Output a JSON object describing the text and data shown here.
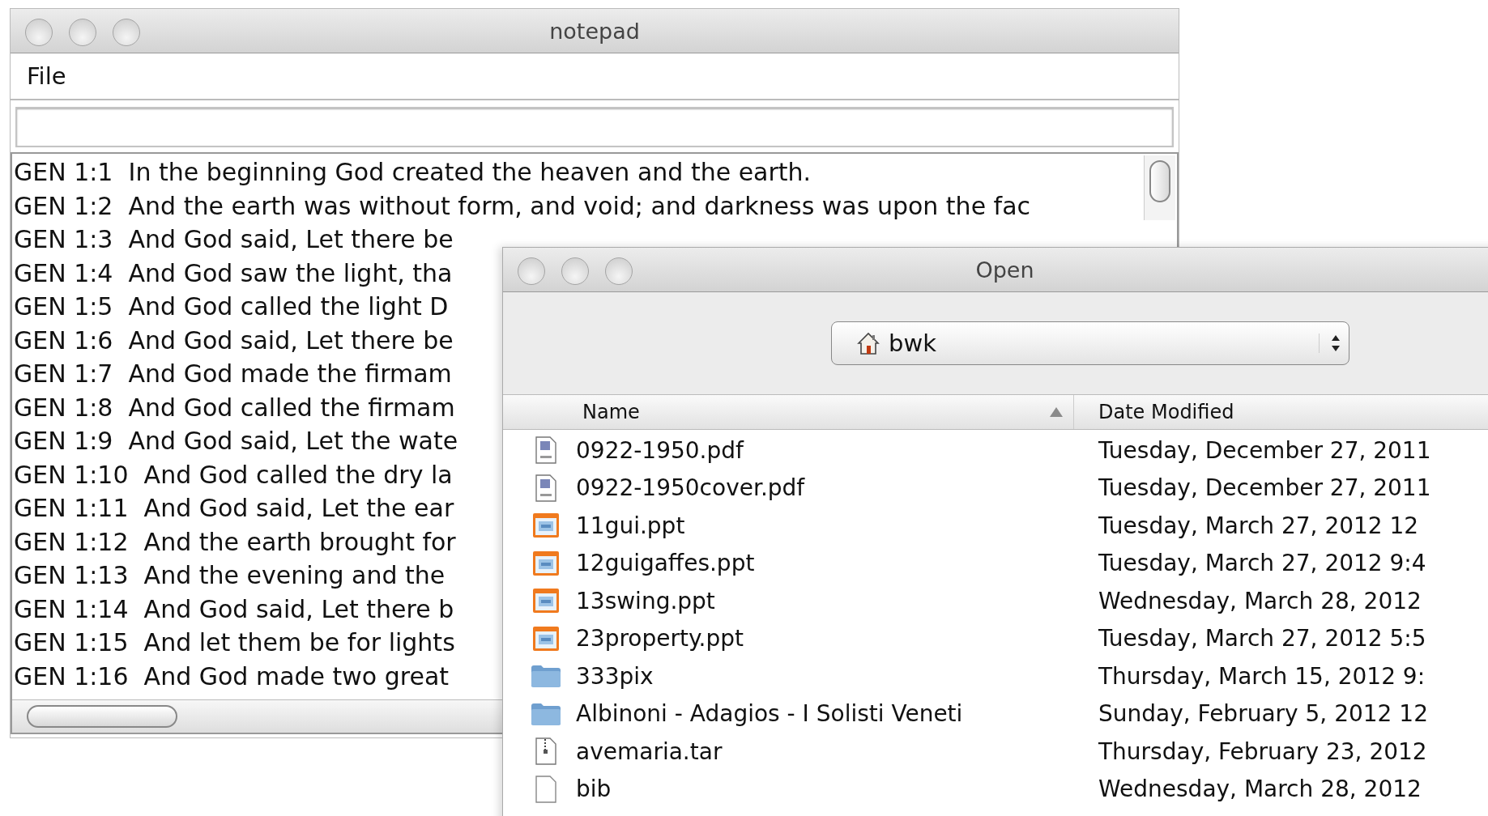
{
  "notepad": {
    "title": "notepad",
    "menu": [
      {
        "label": "File"
      }
    ],
    "lines": [
      "GEN 1:1  In the beginning God created the heaven and the earth.",
      "GEN 1:2  And the earth was without form, and void; and darkness was upon the fac",
      "GEN 1:3  And God said, Let there be",
      "GEN 1:4  And God saw the light, tha",
      "GEN 1:5  And God called the light D",
      "GEN 1:6  And God said, Let there be",
      "GEN 1:7  And God made the firmam",
      "GEN 1:8  And God called the firmam",
      "GEN 1:9  And God said, Let the wate",
      "GEN 1:10  And God called the dry la",
      "GEN 1:11  And God said, Let the ear",
      "GEN 1:12  And the earth brought for",
      "GEN 1:13  And the evening and the",
      "GEN 1:14  And God said, Let there b",
      "GEN 1:15  And let them be for lights",
      "GEN 1:16  And God made two great"
    ]
  },
  "open_dialog": {
    "title": "Open",
    "location": "bwk",
    "columns": [
      {
        "label": "Name",
        "sorted": true
      },
      {
        "label": "Date Modified",
        "sorted": false
      }
    ],
    "files": [
      {
        "name": "0922-1950.pdf",
        "date": "Tuesday, December 27, 2011",
        "kind": "pdf"
      },
      {
        "name": "0922-1950cover.pdf",
        "date": "Tuesday, December 27, 2011",
        "kind": "pdf"
      },
      {
        "name": "11gui.ppt",
        "date": "Tuesday, March 27, 2012 12",
        "kind": "ppt"
      },
      {
        "name": "12guigaffes.ppt",
        "date": "Tuesday, March 27, 2012 9:4",
        "kind": "ppt"
      },
      {
        "name": "13swing.ppt",
        "date": "Wednesday, March 28, 2012",
        "kind": "ppt"
      },
      {
        "name": "23property.ppt",
        "date": "Tuesday, March 27, 2012 5:5",
        "kind": "ppt"
      },
      {
        "name": "333pix",
        "date": "Thursday, March 15, 2012 9:",
        "kind": "folder"
      },
      {
        "name": "Albinoni - Adagios - I Solisti Veneti",
        "date": "Sunday, February 5, 2012 12",
        "kind": "folder"
      },
      {
        "name": "avemaria.tar",
        "date": "Thursday, February 23, 2012",
        "kind": "archive"
      },
      {
        "name": "bib",
        "date": "Wednesday, March 28, 2012",
        "kind": "file"
      }
    ]
  }
}
